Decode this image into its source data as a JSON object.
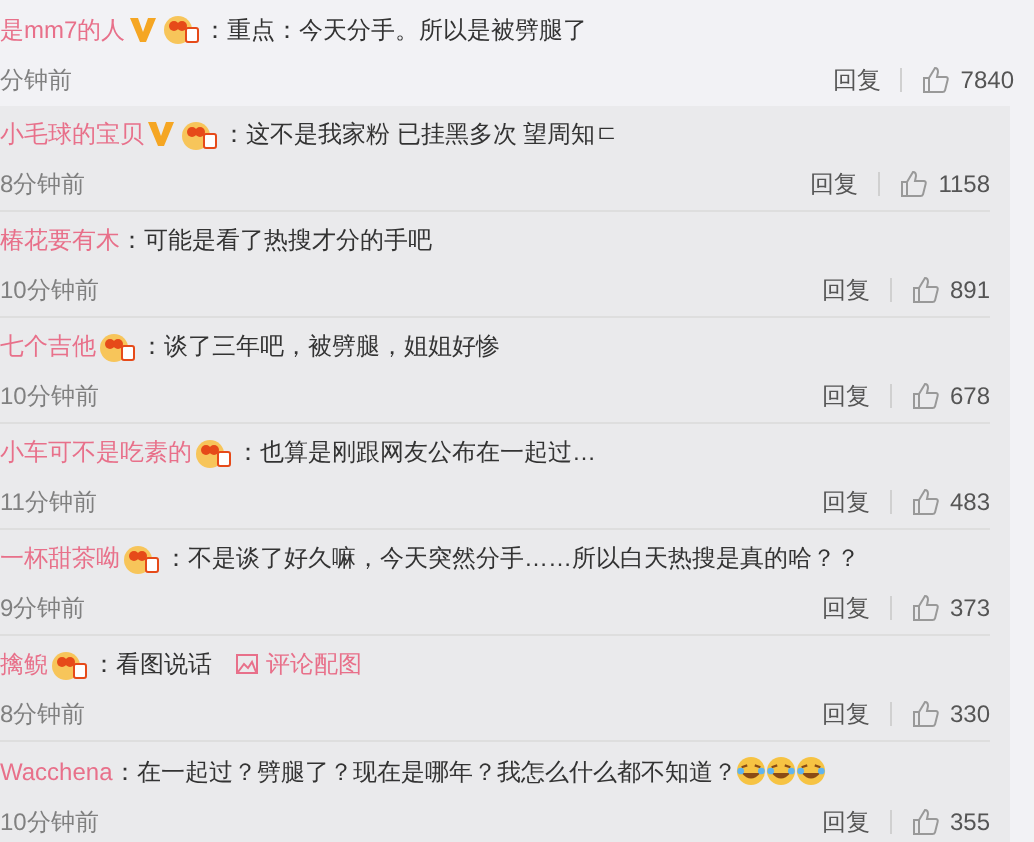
{
  "top_comment": {
    "name": "是mm7的人",
    "verified": true,
    "fan_badge": true,
    "text": "：重点：今天分手。所以是被劈腿了",
    "time": "分钟前",
    "reply": "回复",
    "likes": "7840"
  },
  "replies": [
    {
      "name": "小毛球的宝贝",
      "verified": true,
      "fan_badge": true,
      "text": "：这不是我家粉 已挂黑多次 望周知ㄷ",
      "time": "8分钟前",
      "reply": "回复",
      "likes": "1158"
    },
    {
      "name": "椿花要有木",
      "verified": false,
      "fan_badge": false,
      "text": "：可能是看了热搜才分的手吧",
      "time": "10分钟前",
      "reply": "回复",
      "likes": "891"
    },
    {
      "name": "七个吉他",
      "verified": false,
      "fan_badge": true,
      "text": "：谈了三年吧，被劈腿，姐姐好惨",
      "time": "10分钟前",
      "reply": "回复",
      "likes": "678"
    },
    {
      "name": "小车可不是吃素的",
      "verified": false,
      "fan_badge": true,
      "text": "：也算是刚跟网友公布在一起过…",
      "time": "11分钟前",
      "reply": "回复",
      "likes": "483"
    },
    {
      "name": "一杯甜茶呦",
      "verified": false,
      "fan_badge": true,
      "text": "：不是谈了好久嘛，今天突然分手……所以白天热搜是真的哈？？",
      "time": "9分钟前",
      "reply": "回复",
      "likes": "373"
    },
    {
      "name": "擒鲵",
      "verified": false,
      "fan_badge": true,
      "text": "：看图说话",
      "image_link": "评论配图",
      "time": "8分钟前",
      "reply": "回复",
      "likes": "330"
    },
    {
      "name": "Wacchena",
      "verified": false,
      "fan_badge": false,
      "text": "：在一起过？劈腿了？现在是哪年？我怎么什么都不知道？",
      "emojis": [
        {
          "kind": "laughing-crying"
        },
        {
          "kind": "laughing-crying"
        },
        {
          "kind": "laughing-crying"
        }
      ],
      "time": "10分钟前",
      "reply": "回复",
      "likes": "355"
    }
  ]
}
